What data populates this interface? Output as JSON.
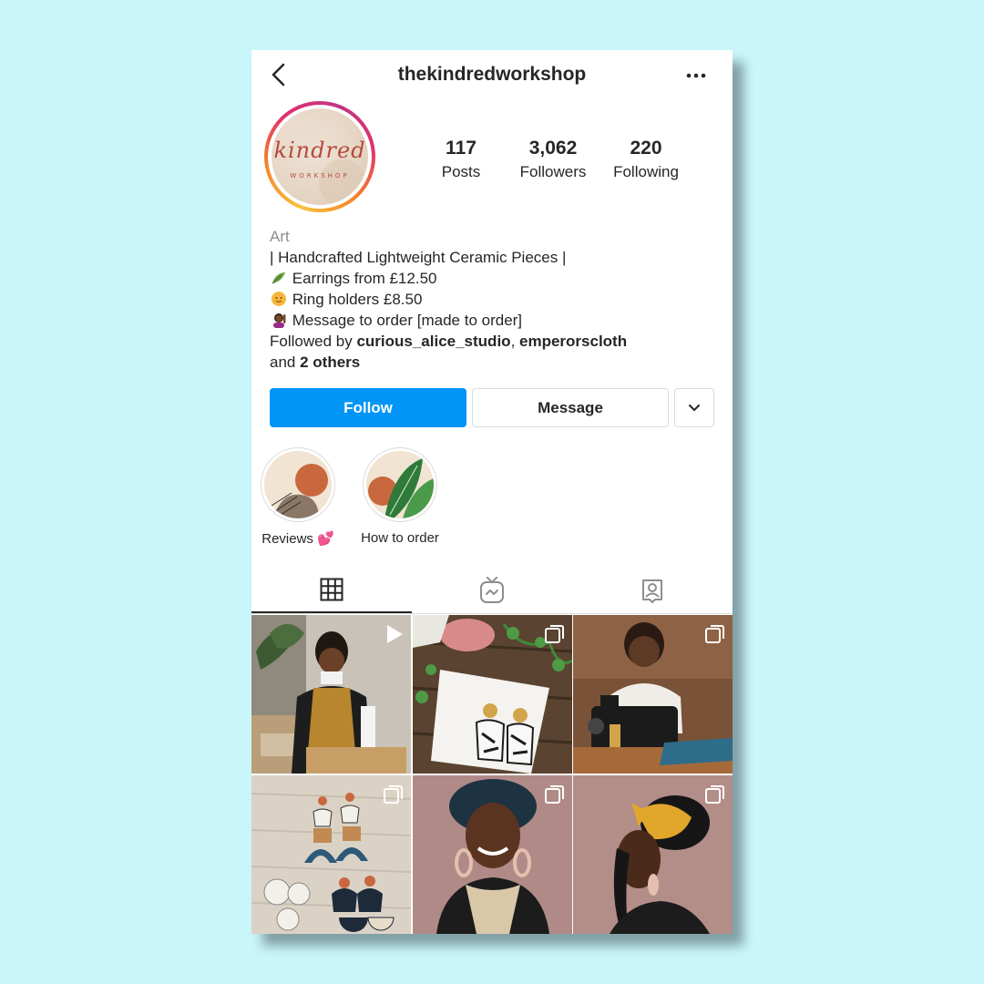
{
  "profile": {
    "username": "thekindredworkshop",
    "avatar_text": "kindred",
    "avatar_subtext": "WORKSHOP",
    "stats": [
      {
        "count": "117",
        "label": "Posts"
      },
      {
        "count": "3,062",
        "label": "Followers"
      },
      {
        "count": "220",
        "label": "Following"
      }
    ],
    "category": "Art",
    "bio_lines": [
      "| Handcrafted Lightweight Ceramic Pieces |",
      "Earrings from £12.50",
      "Ring holders £8.50",
      "Message to order [made to order]"
    ],
    "bio_emojis": [
      "leaf-emoji",
      "sun-emoji",
      "person-raising-hand-emoji"
    ],
    "followed_by": {
      "prefix": "Followed by ",
      "user1": "curious_alice_studio",
      "separator": ", ",
      "user2": "emperorscloth",
      "and_text": "and ",
      "others": "2 others"
    }
  },
  "actions": {
    "follow_label": "Follow",
    "message_label": "Message",
    "more_icon": "chevron-down-icon"
  },
  "highlights": [
    {
      "label": "Reviews 💕"
    },
    {
      "label": "How to order"
    }
  ],
  "tabs": [
    {
      "icon": "grid-icon",
      "active": true
    },
    {
      "icon": "igtv-icon",
      "active": false
    },
    {
      "icon": "tagged-icon",
      "active": false
    }
  ],
  "posts": [
    {
      "type": "video",
      "badge_icon": "play-icon"
    },
    {
      "type": "carousel",
      "badge_icon": "multiple-icon"
    },
    {
      "type": "carousel",
      "badge_icon": "multiple-icon"
    },
    {
      "type": "carousel",
      "badge_icon": "multiple-icon"
    },
    {
      "type": "carousel",
      "badge_icon": "multiple-icon"
    },
    {
      "type": "carousel",
      "badge_icon": "multiple-icon"
    }
  ],
  "colors": {
    "background": "#c9f6fb",
    "follow_button": "#0095f6",
    "text": "#262626",
    "muted_text": "#8e8e8e"
  }
}
